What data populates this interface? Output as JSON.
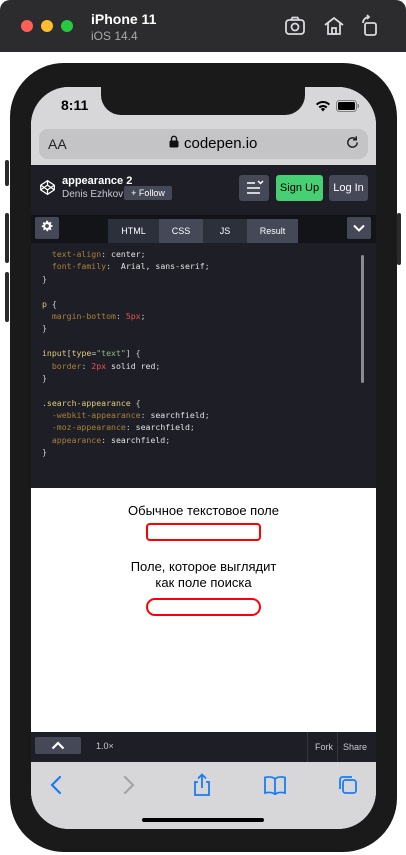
{
  "simulator": {
    "device": "iPhone 11",
    "os": "iOS 14.4"
  },
  "status_bar": {
    "time": "8:11"
  },
  "safari": {
    "text_size_label": "AA",
    "url": "codepen.io"
  },
  "codepen": {
    "pen_title": "appearance 2",
    "author": "Denis Ezhkov",
    "follow_label": "+ Follow",
    "signup_label": "Sign Up",
    "login_label": "Log In",
    "tabs": [
      "HTML",
      "CSS",
      "JS",
      "Result"
    ],
    "active_tab": "CSS",
    "zoom": "1.0×",
    "fork_label": "Fork",
    "share_label": "Share"
  },
  "code_lines": [
    "  text-align: center;",
    "  font-family:  Arial, sans-serif;",
    "}",
    "",
    "p {",
    "  margin-bottom: 5px;",
    "}",
    "",
    "input[type=\"text\"] {",
    "  border: 2px solid red;",
    "}",
    "",
    ".search-appearance {",
    "  -webkit-appearance: searchfield;",
    "  -moz-appearance: searchfield;",
    "  appearance: searchfield;",
    "}"
  ],
  "result": {
    "label_plain": "Обычное текстовое поле",
    "label_search_line1": "Поле, которое выглядит",
    "label_search_line2": "как поле поиска"
  },
  "colors": {
    "accent_green": "#47cf73",
    "border_red": "#ff0000"
  }
}
